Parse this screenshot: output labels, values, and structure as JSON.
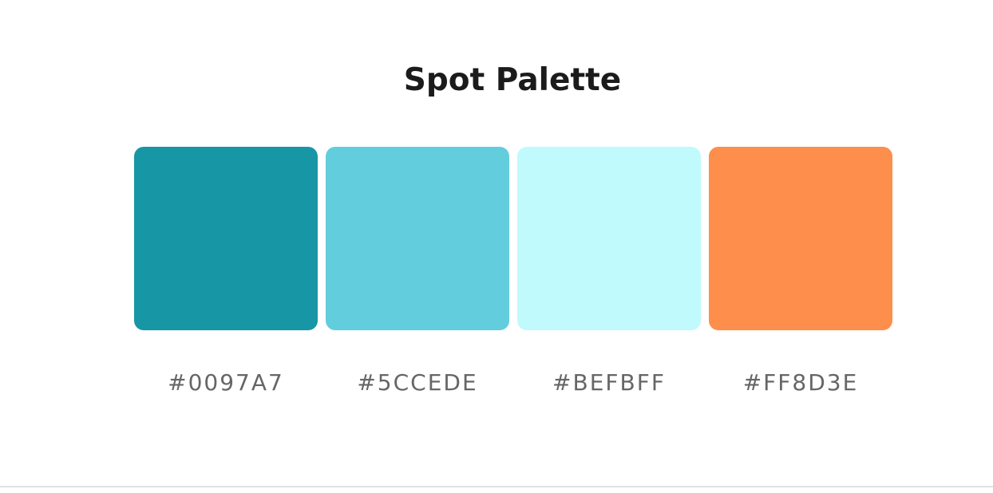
{
  "title": "Spot Palette",
  "swatches": [
    {
      "hex": "#0097A7",
      "display_color": "#1796A5"
    },
    {
      "hex": "#5CCEDE",
      "display_color": "#62CDDD"
    },
    {
      "hex": "#BEFBFF",
      "display_color": "#C0FAFD"
    },
    {
      "hex": "#FF8D3E",
      "display_color": "#FE8E4B"
    }
  ]
}
